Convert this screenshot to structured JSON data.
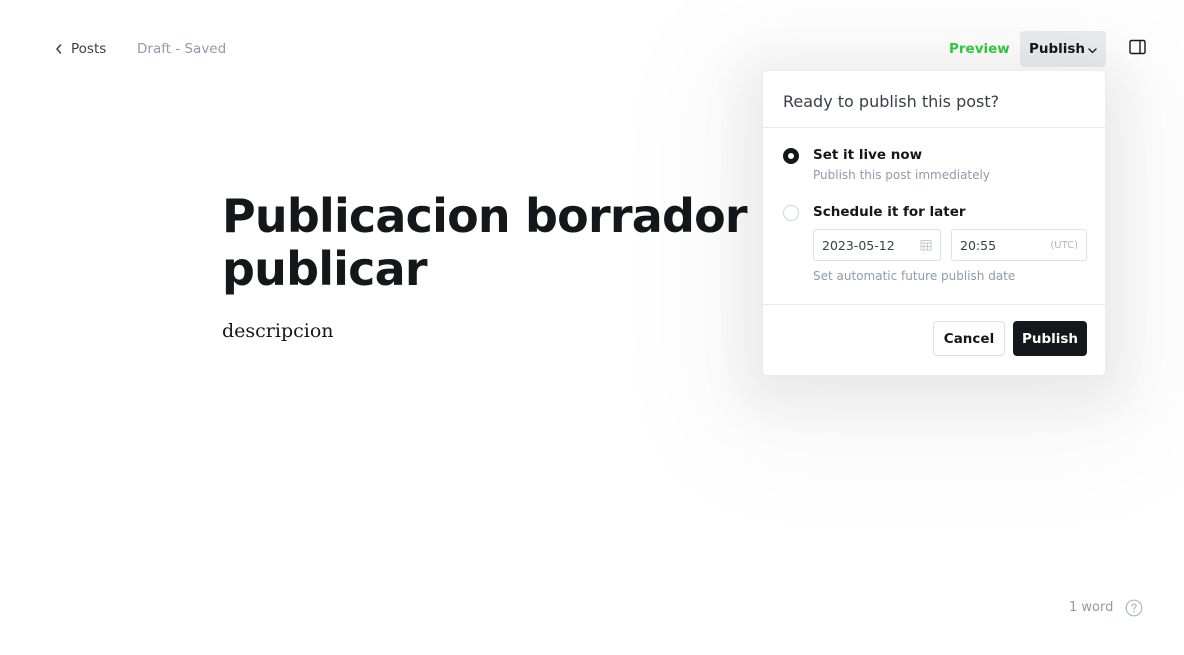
{
  "header": {
    "back_label": "Posts",
    "status": "Draft - Saved",
    "preview_label": "Preview",
    "publish_label": "Publish"
  },
  "editor": {
    "title": "Publicacion borrador editar y publicar",
    "body": "descripcion"
  },
  "publish_menu": {
    "heading": "Ready to publish this post?",
    "options": [
      {
        "title": "Set it live now",
        "subtitle": "Publish this post immediately",
        "selected": true
      },
      {
        "title": "Schedule it for later",
        "selected": false
      }
    ],
    "date_value": "2023-05-12",
    "time_value": "20:55",
    "timezone": "(UTC)",
    "schedule_hint": "Set automatic future publish date",
    "cancel_label": "Cancel",
    "publish_label": "Publish"
  },
  "footer": {
    "word_count": "1 word"
  },
  "colors": {
    "accent_green": "#30cf43",
    "primary_dark": "#15171a",
    "muted_text": "#8e9cac"
  },
  "icons": [
    "chevron-left-icon",
    "chevron-down-icon",
    "sidebar-toggle-icon",
    "calendar-icon",
    "help-icon"
  ]
}
